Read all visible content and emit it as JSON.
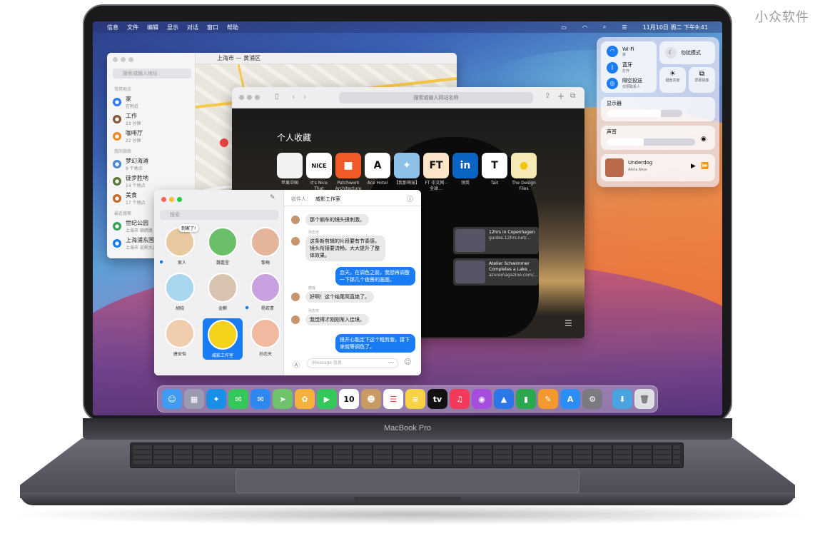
{
  "watermark": "小众软件",
  "laptop_label": "MacBook Pro",
  "menubar": {
    "apple": "",
    "items": [
      "信息",
      "文件",
      "编辑",
      "显示",
      "对话",
      "窗口",
      "帮助"
    ],
    "datetime": "11月10日 周二 下午9:41"
  },
  "maps": {
    "location": "上海市 — 黄浦区",
    "search_placeholder": "搜索或输入地址",
    "favorites_header": "常用地点",
    "favorites": [
      {
        "name": "家",
        "sub": "在附近",
        "color": "#2f7cf6",
        "icon": "home-icon"
      },
      {
        "name": "工作",
        "sub": "23 分钟",
        "color": "#8a5a3c",
        "icon": "briefcase-icon"
      },
      {
        "name": "咖啡厅",
        "sub": "22 分钟",
        "color": "#f08a24",
        "icon": "coffee-icon"
      }
    ],
    "guides_header": "我的指南",
    "guides": [
      {
        "name": "梦幻海滩",
        "sub": "9 个地点",
        "color": "#4a8ac9"
      },
      {
        "name": "徒步胜地",
        "sub": "14 个地点",
        "color": "#5a7a3a"
      },
      {
        "name": "美食",
        "sub": "17 个地点",
        "color": "#c46a2a"
      }
    ],
    "recent_header": "最近搜索",
    "recents": [
      {
        "name": "世纪公园",
        "sub": "上海市 锦绣路",
        "color": "#3aa35a"
      },
      {
        "name": "上海浦东国际机场",
        "sub": "上海市 迎宾大道",
        "color": "#1a7cf5"
      }
    ]
  },
  "safari": {
    "url_placeholder": "搜索或输入网站名称",
    "favorites_title": "个人收藏",
    "favorites": [
      {
        "label": "苹果中国",
        "glyph": "",
        "bg": "#f2f2f2",
        "fg": "#111"
      },
      {
        "label": "It's Nice That",
        "glyph": "NICE",
        "bg": "#fff",
        "fg": "#111"
      },
      {
        "label": "Patchwork Architecture",
        "glyph": "■",
        "bg": "#f05a28",
        "fg": "#fff"
      },
      {
        "label": "Ace Hotel",
        "glyph": "A",
        "bg": "#fff",
        "fg": "#111"
      },
      {
        "label": "【我那萌宠】",
        "glyph": "✦",
        "bg": "#8ec1e8",
        "fg": "#fff"
      },
      {
        "label": "FT 中文网 - 全球…",
        "glyph": "FT",
        "bg": "#fce4c8",
        "fg": "#111"
      },
      {
        "label": "领英",
        "glyph": "in",
        "bg": "#0a66c2",
        "fg": "#fff"
      },
      {
        "label": "Tait",
        "glyph": "T",
        "bg": "#fff",
        "fg": "#111"
      },
      {
        "label": "The Design Files",
        "glyph": "●",
        "bg": "#f5e9b5",
        "fg": "#f2c40f"
      }
    ],
    "reading": [
      {
        "title": "12hrs in Copenhagen",
        "sub": "guides.12hrs.net/…"
      },
      {
        "title": "Atelier Schwimmer Completes a Lake…",
        "sub": "azuremagazine.com/…"
      }
    ]
  },
  "messages": {
    "search_placeholder": "搜索",
    "recipient_label": "收件人：",
    "recipient": "威影工作室",
    "pins": [
      {
        "name": "家人",
        "color": "#e9c9a0",
        "unread": true,
        "popup": "到家了!"
      },
      {
        "name": "魏嘉莹",
        "color": "#6bbf6b",
        "unread": false
      },
      {
        "name": "黎梅",
        "color": "#e4b59a",
        "unread": false
      },
      {
        "name": "胡晓",
        "color": "#a8d6ef",
        "unread": false
      },
      {
        "name": "金麒",
        "color": "#d8c4b0",
        "unread": false
      },
      {
        "name": "杨若青",
        "color": "#c9a0e0",
        "unread": true
      },
      {
        "name": "唐安怡",
        "color": "#f1cdb0",
        "unread": false
      },
      {
        "name": "威影工作室",
        "color": "#f2d21a",
        "unread": false,
        "selected": true
      },
      {
        "name": "孙志天",
        "color": "#f1b9a0",
        "unread": false
      }
    ],
    "thread": [
      {
        "dir": "in",
        "sender": "",
        "text": "那个躺车的镜头很刺激。"
      },
      {
        "dir": "in",
        "sender": "孙志天",
        "text": "这条新剪辑的片段要有节奏感，镜头衔接要流畅，大大提升了整体效果。"
      },
      {
        "dir": "out",
        "sender": "",
        "text": "恋天，在调色之前，我想再调整一下那几个夜景的画面。"
      },
      {
        "dir": "in",
        "sender": "唐瑶",
        "text": "好啊！这个结尾简直绝了。"
      },
      {
        "dir": "in",
        "sender": "孙志天",
        "text": "我觉得才刚刚渐入佳境。"
      },
      {
        "dir": "out",
        "sender": "",
        "text": "很开心能定下这个粗剪版，接下来就等调色了。"
      }
    ],
    "input_placeholder": "iMessage 信息"
  },
  "control_center": {
    "wifi": {
      "label": "Wi-Fi",
      "sub": "家"
    },
    "bluetooth": {
      "label": "蓝牙",
      "sub": "打开"
    },
    "airdrop": {
      "label": "隔空投送",
      "sub": "仅限联系人"
    },
    "focus": {
      "label": "勿扰模式"
    },
    "keyboard": {
      "label": "键盘亮度"
    },
    "mirroring": {
      "label": "屏幕镜像"
    },
    "display": {
      "label": "显示器",
      "level": 0.72
    },
    "sound": {
      "label": "声音",
      "level": 0.42
    },
    "now_playing": {
      "title": "Underdog",
      "artist": "Alicia Keys"
    }
  },
  "dock": [
    {
      "name": "finder",
      "glyph": "☺",
      "bg": "#3f9cf2"
    },
    {
      "name": "launchpad",
      "glyph": "▦",
      "bg": "#9a9ab0"
    },
    {
      "name": "safari",
      "glyph": "✦",
      "bg": "#1a8fe8"
    },
    {
      "name": "messages",
      "glyph": "✉",
      "bg": "#34c759"
    },
    {
      "name": "mail",
      "glyph": "✉",
      "bg": "#2f88f0"
    },
    {
      "name": "maps",
      "glyph": "➤",
      "bg": "#6fc36a"
    },
    {
      "name": "photos",
      "glyph": "✿",
      "bg": "#f6b13c"
    },
    {
      "name": "facetime",
      "glyph": "▶",
      "bg": "#34c759"
    },
    {
      "name": "calendar",
      "glyph": "10",
      "bg": "#ffffff",
      "fg": "#111"
    },
    {
      "name": "contacts",
      "glyph": "☻",
      "bg": "#c89a64"
    },
    {
      "name": "reminders",
      "glyph": "☰",
      "bg": "#ffffff",
      "fg": "#e44"
    },
    {
      "name": "notes",
      "glyph": "≡",
      "bg": "#f7d244"
    },
    {
      "name": "tv",
      "glyph": "tv",
      "bg": "#111"
    },
    {
      "name": "music",
      "glyph": "♫",
      "bg": "#f43a5a"
    },
    {
      "name": "podcasts",
      "glyph": "◉",
      "bg": "#a64de0"
    },
    {
      "name": "keynote",
      "glyph": "▲",
      "bg": "#2b77e8"
    },
    {
      "name": "numbers",
      "glyph": "▮",
      "bg": "#29a84c"
    },
    {
      "name": "pages",
      "glyph": "✎",
      "bg": "#f29a2e"
    },
    {
      "name": "app-store",
      "glyph": "A",
      "bg": "#2a8ef5"
    },
    {
      "name": "system-preferences",
      "glyph": "⚙",
      "bg": "#7a7a80"
    },
    {
      "name": "downloads",
      "glyph": "⬇",
      "bg": "#4aa3e0"
    },
    {
      "name": "trash",
      "glyph": "🗑",
      "bg": "#dfe0e4",
      "fg": "#777"
    }
  ]
}
